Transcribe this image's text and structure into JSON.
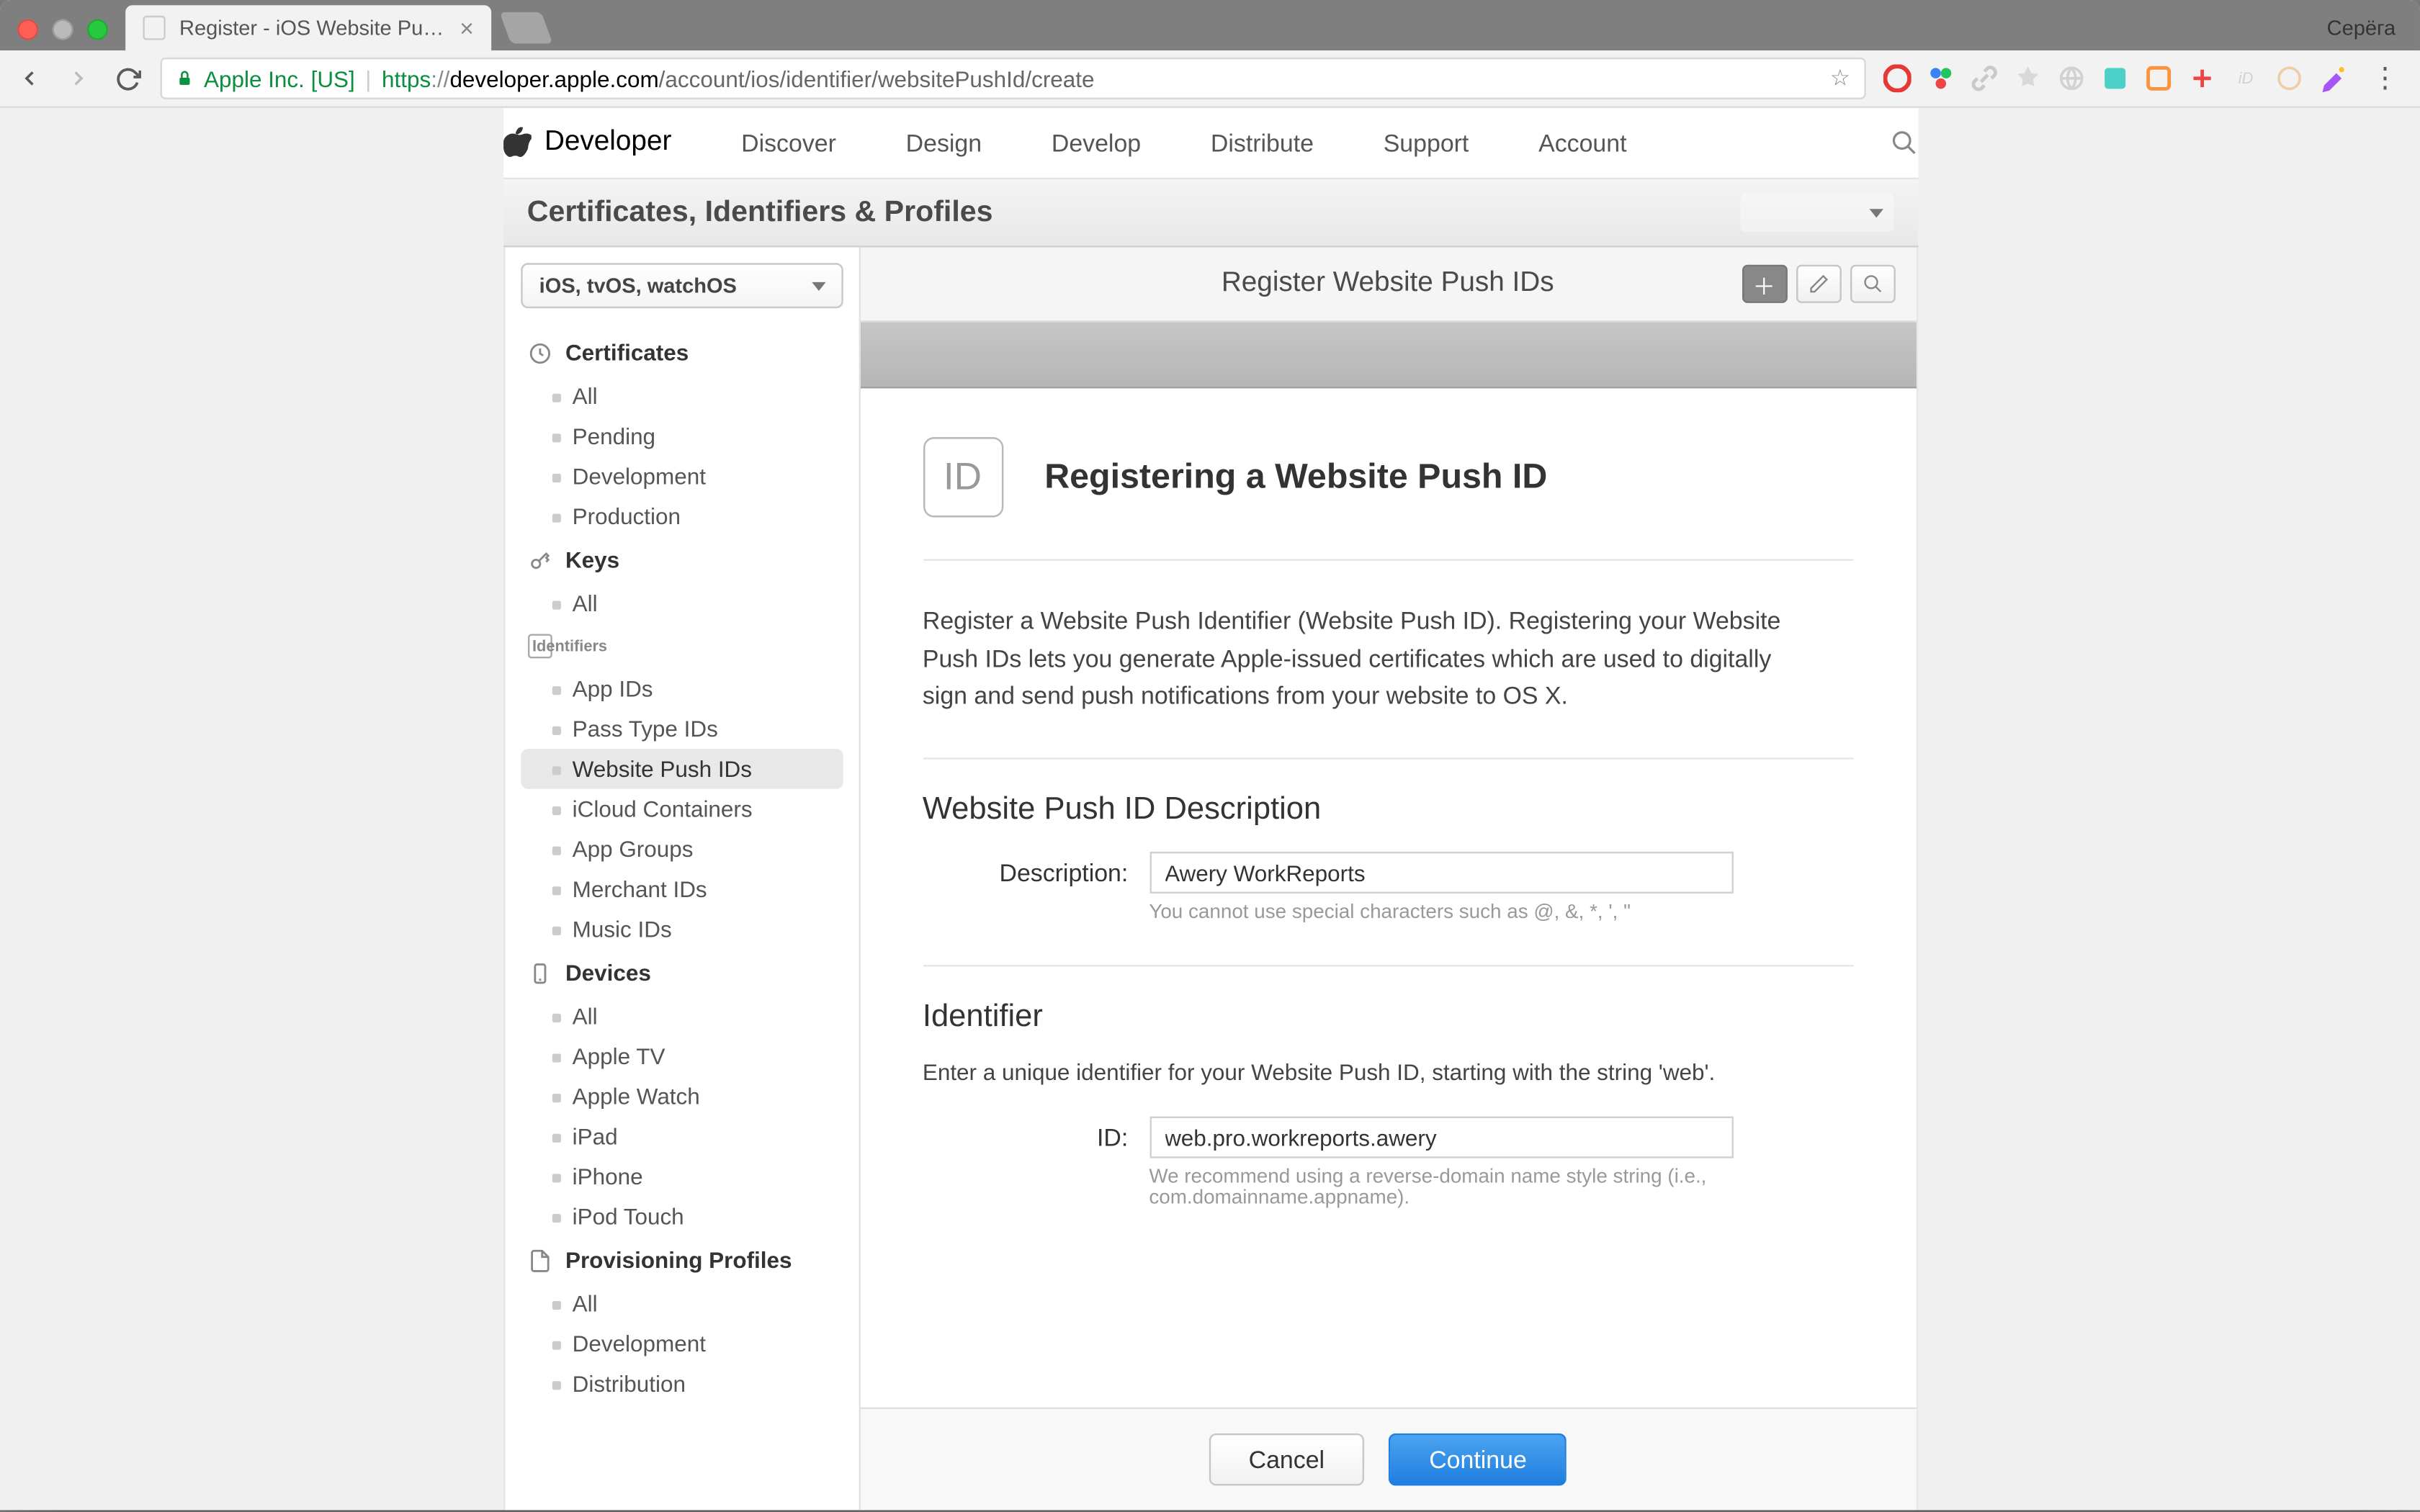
{
  "browser": {
    "tab_title": "Register - iOS Website Push ID",
    "profile_name": "Серёга",
    "url_ev": "Apple Inc. [US]",
    "url_scheme": "https",
    "url_host": "developer.apple.com",
    "url_path": "/account/ios/identifier/websitePushId/create"
  },
  "apple_nav": {
    "brand": "Developer",
    "items": [
      "Discover",
      "Design",
      "Develop",
      "Distribute",
      "Support",
      "Account"
    ]
  },
  "subheader": {
    "title": "Certificates, Identifiers & Profiles"
  },
  "sidebar": {
    "platform_label": "iOS, tvOS, watchOS",
    "groups": [
      {
        "title": "Certificates",
        "items": [
          "All",
          "Pending",
          "Development",
          "Production"
        ],
        "active": null
      },
      {
        "title": "Keys",
        "items": [
          "All"
        ],
        "active": null
      },
      {
        "title": "Identifiers",
        "items": [
          "App IDs",
          "Pass Type IDs",
          "Website Push IDs",
          "iCloud Containers",
          "App Groups",
          "Merchant IDs",
          "Music IDs"
        ],
        "active": "Website Push IDs"
      },
      {
        "title": "Devices",
        "items": [
          "All",
          "Apple TV",
          "Apple Watch",
          "iPad",
          "iPhone",
          "iPod Touch"
        ],
        "active": null
      },
      {
        "title": "Provisioning Profiles",
        "items": [
          "All",
          "Development",
          "Distribution"
        ],
        "active": null
      }
    ]
  },
  "main": {
    "page_title": "Register Website Push IDs",
    "box_title": "Registering a Website Push ID",
    "intro": "Register a Website Push Identifier (Website Push ID). Registering your Website Push IDs lets you generate Apple-issued certificates which are used to digitally sign and send push notifications from your website to OS X.",
    "desc_section": {
      "heading": "Website Push ID Description",
      "label": "Description:",
      "value": "Awery WorkReports",
      "hint": "You cannot use special characters such as @, &, *, ', \""
    },
    "id_section": {
      "heading": "Identifier",
      "sub": "Enter a unique identifier for your Website Push ID, starting with the string 'web'.",
      "label": "ID:",
      "value": "web.pro.workreports.awery",
      "hint": "We recommend using a reverse-domain name style string (i.e., com.domainname.appname)."
    },
    "cancel": "Cancel",
    "continue": "Continue",
    "id_badge": "ID"
  }
}
